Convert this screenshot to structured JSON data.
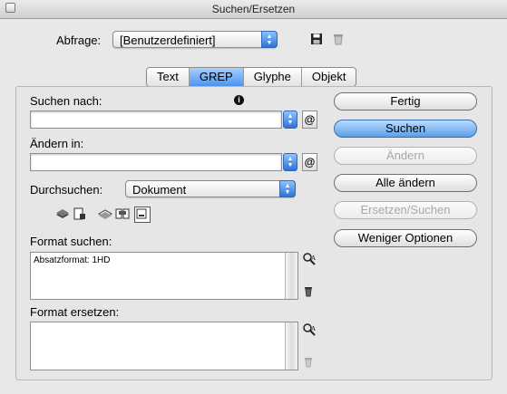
{
  "window": {
    "title": "Suchen/Ersetzen"
  },
  "query": {
    "label": "Abfrage:",
    "value": "[Benutzerdefiniert]"
  },
  "tabs": [
    {
      "label": "Text",
      "active": false
    },
    {
      "label": "GREP",
      "active": true
    },
    {
      "label": "Glyphe",
      "active": false
    },
    {
      "label": "Objekt",
      "active": false
    }
  ],
  "search": {
    "label": "Suchen nach:",
    "value": ""
  },
  "replace": {
    "label": "Ändern in:",
    "value": ""
  },
  "scope": {
    "label": "Durchsuchen:",
    "value": "Dokument"
  },
  "format_search": {
    "label": "Format suchen:",
    "value": "Absatzformat: 1HD"
  },
  "format_replace": {
    "label": "Format ersetzen:",
    "value": ""
  },
  "buttons": {
    "done": "Fertig",
    "find": "Suchen",
    "change": "Ändern",
    "change_all": "Alle ändern",
    "change_find": "Ersetzen/Suchen",
    "fewer_options": "Weniger Optionen"
  },
  "colors": {
    "accent": "#4c93ee",
    "disabled_text": "#a8a8a8"
  }
}
